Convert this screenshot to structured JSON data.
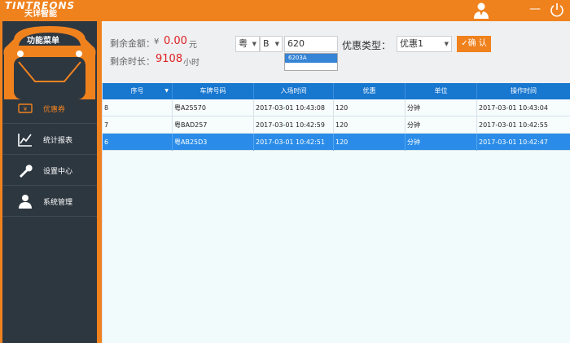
{
  "app": {
    "logo": "TINTREONS",
    "logo_sub": "天详智能"
  },
  "sidebar": {
    "menu_title": "功能菜单",
    "items": [
      {
        "label": "优惠券",
        "icon": "coupon-icon"
      },
      {
        "label": "统计报表",
        "icon": "chart-icon"
      },
      {
        "label": "设置中心",
        "icon": "wrench-icon"
      },
      {
        "label": "系统管理",
        "icon": "admin-user-icon"
      }
    ]
  },
  "info": {
    "balance_label": "剩余金额：",
    "currency": "¥",
    "balance_value": "0.00",
    "balance_unit": "元",
    "time_label": "剩余时长：",
    "time_value": "9108",
    "time_unit": "小时"
  },
  "filter": {
    "province": "粤",
    "letter": "B",
    "plate_value": "620",
    "suggestions": [
      "6203A"
    ],
    "type_label": "优惠类型：",
    "type_value": "优惠1",
    "confirm_label": "确 认"
  },
  "table": {
    "headers": [
      "序号",
      "车牌号码",
      "入场时间",
      "优惠",
      "单位",
      "操作时间"
    ],
    "rows": [
      [
        "8",
        "粤A25570",
        "2017-03-01 10:43:08",
        "120",
        "分钟",
        "2017-03-01 10:43:04"
      ],
      [
        "7",
        "粤BAD257",
        "2017-03-01 10:42:59",
        "120",
        "分钟",
        "2017-03-01 10:42:55"
      ],
      [
        "6",
        "粤AB25D3",
        "2017-03-01 10:42:51",
        "120",
        "分钟",
        "2017-03-01 10:42:47"
      ]
    ]
  },
  "colors": {
    "accent": "#f0821e",
    "header_blue": "#1877cf",
    "selected_row": "#2a8ce8",
    "sidebar_bg": "#2d3740",
    "value_red": "#e02020"
  }
}
